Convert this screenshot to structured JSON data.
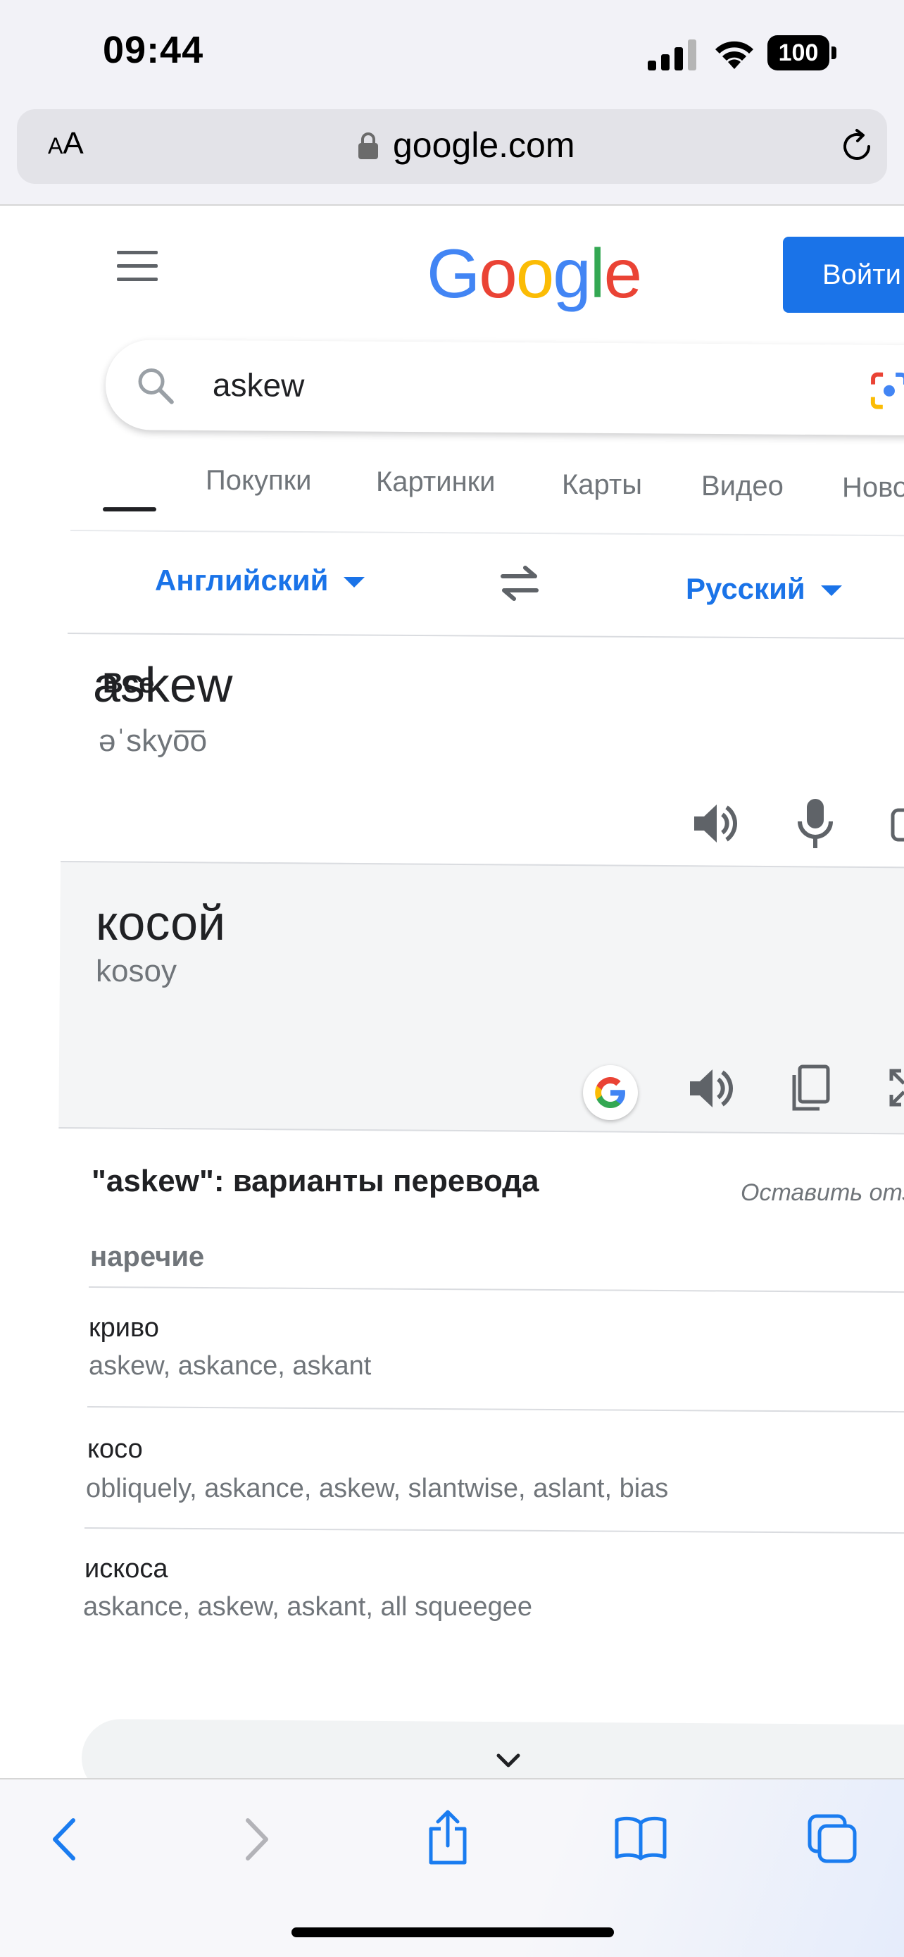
{
  "status_bar": {
    "time": "09:44",
    "battery": "100"
  },
  "browser": {
    "text_size_small": "A",
    "text_size_large": "A",
    "url": "google.com"
  },
  "header": {
    "logo_letters": [
      "G",
      "o",
      "o",
      "g",
      "l",
      "e"
    ],
    "signin_label": "Войти"
  },
  "search": {
    "query": "askew"
  },
  "tabs": [
    {
      "label": "Все",
      "active": true
    },
    {
      "label": "Покупки",
      "active": false
    },
    {
      "label": "Картинки",
      "active": false
    },
    {
      "label": "Карты",
      "active": false
    },
    {
      "label": "Видео",
      "active": false
    },
    {
      "label": "Новости",
      "active": false
    }
  ],
  "translator": {
    "source_language": "Английский",
    "target_language": "Русский",
    "source_word": "askew",
    "source_phonetic": "əˈskyo͞o",
    "target_word": "косой",
    "target_transliteration": "kosoy"
  },
  "variants": {
    "title": "\"askew\": варианты перевода",
    "feedback": "Оставить отзыв",
    "part_of_speech": "наречие",
    "items": [
      {
        "word": "криво",
        "synonyms": "askew, askance, askant"
      },
      {
        "word": "косо",
        "synonyms": "obliquely, askance, askew, slantwise, aslant, bias"
      },
      {
        "word": "искоса",
        "synonyms": "askance, askew, askant, all squeegee"
      }
    ]
  },
  "colors": {
    "google_blue": "#4285F4",
    "google_red": "#EA4335",
    "google_yellow": "#FBBC05",
    "google_green": "#34A853",
    "accent": "#1a73e8",
    "ios_blue": "#1a7cf0"
  }
}
